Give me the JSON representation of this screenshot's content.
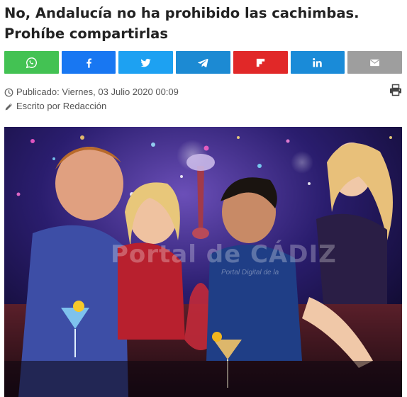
{
  "article": {
    "title": "No, Andalucía no ha prohibido las cachimbas. Prohíbe compartirlas",
    "published_label": "Publicado: Viernes, 03 Julio 2020 00:09",
    "author_label": "Escrito por Redacción"
  },
  "share": {
    "buttons": [
      {
        "network": "whatsapp",
        "icon": "whatsapp-icon",
        "color": "#43c253"
      },
      {
        "network": "facebook",
        "icon": "facebook-icon",
        "color": "#1877f2"
      },
      {
        "network": "twitter",
        "icon": "twitter-icon",
        "color": "#1da1f2"
      },
      {
        "network": "telegram",
        "icon": "telegram-icon",
        "color": "#1c8ad3"
      },
      {
        "network": "flipboard",
        "icon": "flipboard-icon",
        "color": "#e12828"
      },
      {
        "network": "linkedin",
        "icon": "linkedin-icon",
        "color": "#1a8bd8"
      },
      {
        "network": "email",
        "icon": "email-icon",
        "color": "#9e9e9e"
      }
    ]
  },
  "image": {
    "watermark": "Portal de CÁDIZ",
    "watermark_sub": "Portal Digital de la"
  },
  "icons": {
    "published": "clock-icon",
    "author": "pencil-icon",
    "print": "print-icon"
  }
}
